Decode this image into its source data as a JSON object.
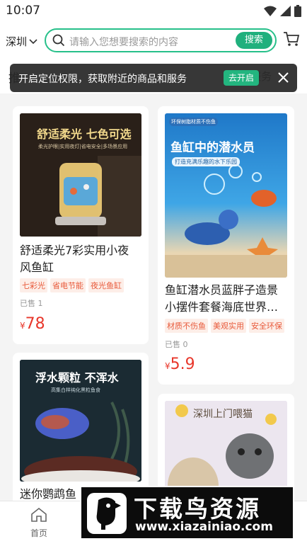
{
  "status_bar": {
    "time": "10:07"
  },
  "header": {
    "city": "深圳",
    "search_placeholder": "请输入您想要搜索的内容",
    "search_button": "搜索"
  },
  "tabs": {
    "left_fragment": "推",
    "right_fragment": "服务"
  },
  "location_toast": {
    "text": "开启定位权限，获取附近的商品和服务",
    "button": "去开启"
  },
  "products": [
    {
      "image_caption": "舒适柔光 七色可选",
      "image_subcaption": "柔光护眼|实用夜灯|省电安全|多场景应用",
      "title_line1": "舒适柔光7彩实用小夜",
      "title_line2": "风鱼缸",
      "tags": [
        "七彩光",
        "省电节能",
        "夜光鱼缸"
      ],
      "sold": "已售 1",
      "currency": "¥",
      "price": "78"
    },
    {
      "image_badge": "环保树脂材质不伤鱼",
      "image_caption": "鱼缸中的潜水员",
      "image_subcaption": "打造充满乐趣的水下乐园",
      "title_line1": "鱼缸潜水员蓝胖子造景",
      "title_line2": "小摆件套餐海底世界…",
      "tags": [
        "材质不伤鱼",
        "美观实用",
        "安全环保"
      ],
      "sold": "已售 0",
      "currency": "¥",
      "price": "5.9"
    },
    {
      "image_caption": "浮水颗粒 不浑水",
      "image_subcaption": "高集白样纯化黑粒鱼食",
      "title_line1": "迷你鹦鹉鱼"
    },
    {
      "image_caption": "深圳上门喂猫"
    }
  ],
  "bottom_nav": {
    "home_label": "首页"
  },
  "watermark": {
    "title": "下载鸟资源",
    "url": "www.xiazainiao.com"
  },
  "colors": {
    "accent": "#20b07d",
    "price": "#e8372b",
    "tag_text": "#e85a3b",
    "tag_bg": "#fdeee8"
  }
}
